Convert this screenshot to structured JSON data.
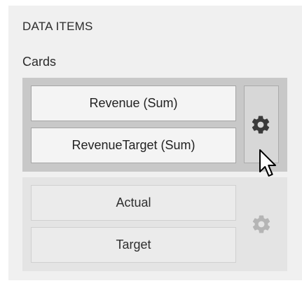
{
  "panel": {
    "title": "DATA ITEMS",
    "group_label": "Cards"
  },
  "card_groups": [
    {
      "state": "active",
      "items": [
        {
          "label": "Revenue (Sum)"
        },
        {
          "label": "RevenueTarget (Sum)"
        }
      ],
      "options_icon": "gear-icon"
    },
    {
      "state": "inactive",
      "items": [
        {
          "label": "Actual"
        },
        {
          "label": "Target"
        }
      ],
      "options_icon": "gear-icon"
    }
  ],
  "colors": {
    "panel_background": "#f0f0f0",
    "active_group_background": "#c8c8c8",
    "inactive_group_background": "#e4e4e4",
    "active_gear": "#3a3a3a",
    "inactive_gear": "#b5b5b5"
  },
  "cursor": "mouse-pointer-icon"
}
